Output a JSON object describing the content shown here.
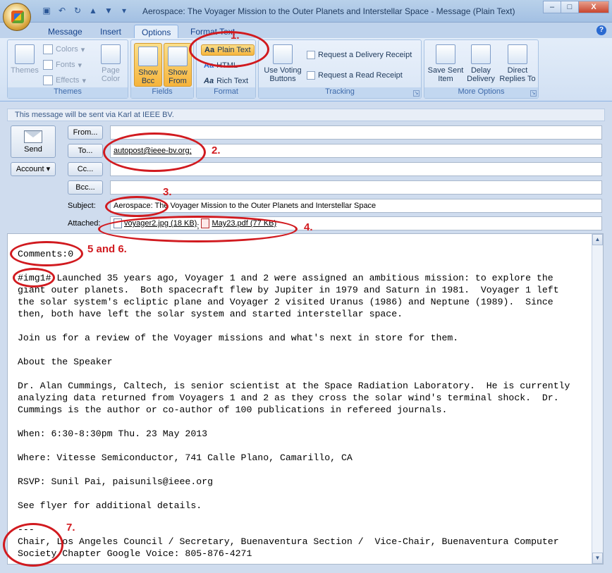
{
  "window": {
    "title": "Aerospace: The Voyager Mission to the Outer Planets and Interstellar Space  -  Message (Plain Text)",
    "qat_icons": [
      "save-icon",
      "undo-icon",
      "redo-icon",
      "up-arrow-icon",
      "down-arrow-icon",
      "customize-icon"
    ],
    "controls": {
      "minimize": "–",
      "maximize": "□",
      "close": "X"
    }
  },
  "tabs": [
    {
      "label": "Message",
      "active": false
    },
    {
      "label": "Insert",
      "active": false
    },
    {
      "label": "Options",
      "active": true
    },
    {
      "label": "Format Text",
      "active": false
    }
  ],
  "help": "?",
  "ribbon": {
    "themes": {
      "label": "Themes",
      "themes_button": "Themes",
      "colors": "Colors",
      "fonts": "Fonts",
      "effects": "Effects",
      "page_color": "Page Color"
    },
    "fields": {
      "label": "Fields",
      "show_bcc": "Show Bcc",
      "show_from": "Show From"
    },
    "format": {
      "label": "Format",
      "plain_text": "Plain Text",
      "html": "HTML",
      "rich_text": "Rich Text",
      "selected": "Plain Text"
    },
    "tracking": {
      "label": "Tracking",
      "voting": "Use Voting Buttons",
      "delivery_receipt": "Request a Delivery Receipt",
      "read_receipt": "Request a Read Receipt"
    },
    "more": {
      "label": "More Options",
      "save_sent": "Save Sent Item",
      "delay": "Delay Delivery",
      "direct": "Direct Replies To"
    }
  },
  "infobar": "This message will be sent via Karl at IEEE BV.",
  "compose": {
    "send": "Send",
    "account": "Account",
    "from_btn": "From...",
    "to_btn": "To...",
    "cc_btn": "Cc...",
    "bcc_btn": "Bcc...",
    "from_value": "",
    "to_value": "autopost@ieee-bv.org;",
    "cc_value": "",
    "bcc_value": "",
    "subject_label": "Subject:",
    "subject_value": "Aerospace: The Voyager Mission to the Outer Planets and Interstellar Space",
    "attached_label": "Attached:",
    "attachments": [
      {
        "name": "voyager2.jpg (18 KB)",
        "icon": "image-file-icon"
      },
      {
        "name": "May23.pdf (77 KB)",
        "icon": "pdf-file-icon"
      }
    ],
    "separator": ";"
  },
  "body": {
    "lines": [
      "Comments:0",
      "",
      "#img1# Launched 35 years ago, Voyager 1 and 2 were assigned an ambitious mission: to explore the",
      "giant outer planets.  Both spacecraft flew by Jupiter in 1979 and Saturn in 1981.  Voyager 1 left",
      "the solar system's ecliptic plane and Voyager 2 visited Uranus (1986) and Neptune (1989).  Since",
      "then, both have left the solar system and started interstellar space.",
      "",
      "Join us for a review of the Voyager missions and what's next in store for them.",
      "",
      "About the Speaker",
      "",
      "Dr. Alan Cummings, Caltech, is senior scientist at the Space Radiation Laboratory.  He is currently",
      "analyzing data returned from Voyagers 1 and 2 as they cross the solar wind's terminal shock.  Dr.",
      "Cummings is the author or co-author of 100 publications in refereed journals.",
      "",
      "When: 6:30-8:30pm Thu. 23 May 2013",
      "",
      "Where: Vitesse Semiconductor, 741 Calle Plano, Camarillo, CA",
      "",
      "RSVP: Sunil Pai, paisunils@ieee.org",
      "",
      "See flyer for additional details.",
      "",
      "---",
      "Chair, Los Angeles Council / Secretary, Buenaventura Section /  Vice-Chair, Buenaventura Computer",
      "Society Chapter Google Voice: 805-876-4271"
    ]
  },
  "annotations": {
    "n1": "1.",
    "n2": "2.",
    "n3": "3.",
    "n4": "4.",
    "n56": "5 and 6.",
    "n7": "7.",
    "color": "#d11a1f"
  }
}
